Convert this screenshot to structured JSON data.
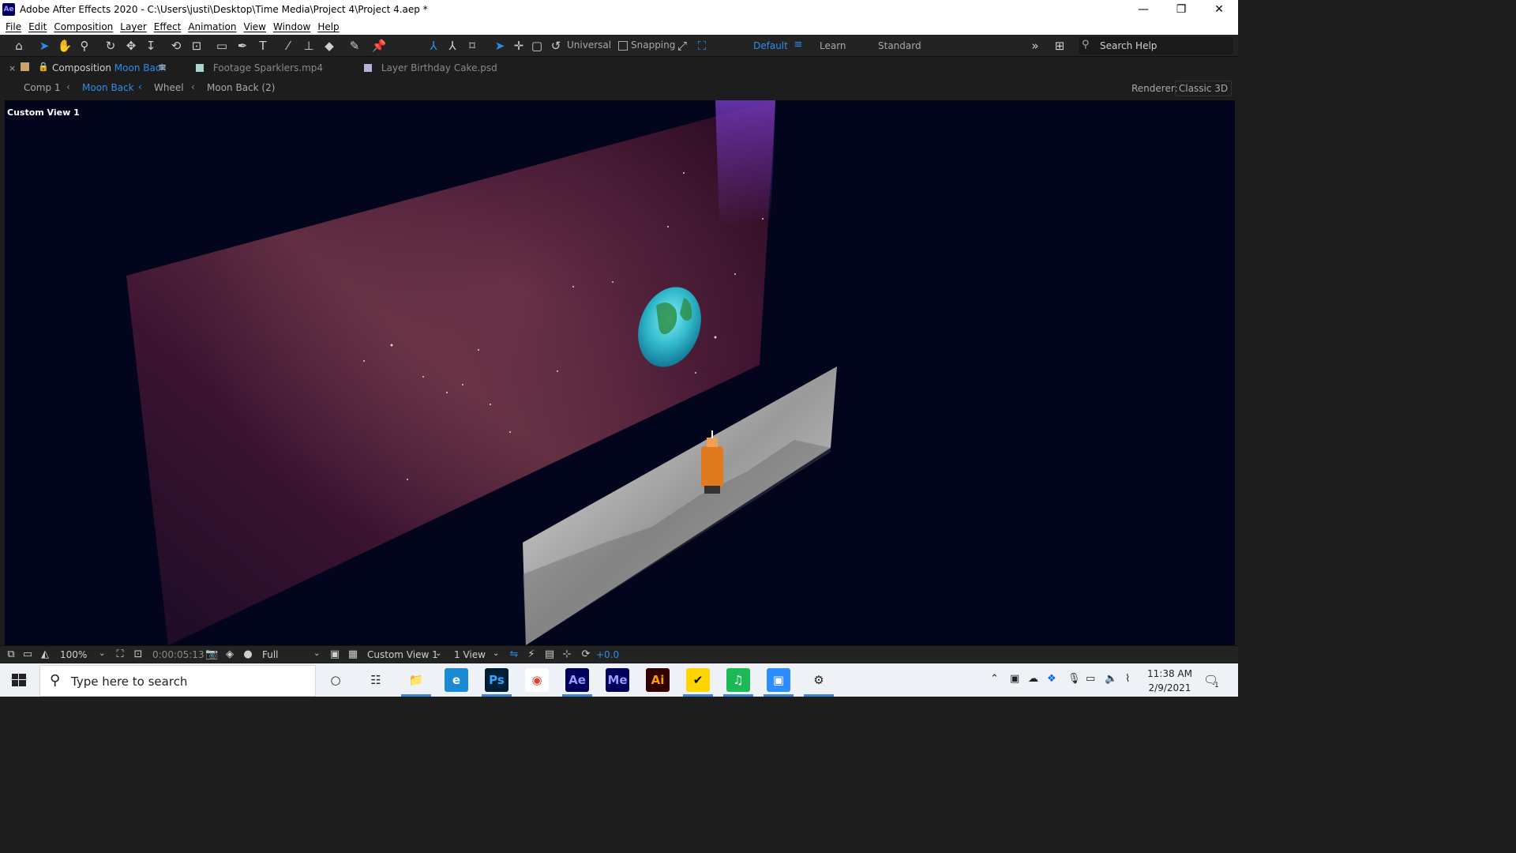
{
  "window": {
    "title": "Adobe After Effects 2020 - C:\\Users\\justi\\Desktop\\Time Media\\Project 4\\Project 4.aep *",
    "app_icon": "Ae",
    "minimize": "—",
    "restore": "❐",
    "close": "✕"
  },
  "menu": [
    "File",
    "Edit",
    "Composition",
    "Layer",
    "Effect",
    "Animation",
    "View",
    "Window",
    "Help"
  ],
  "toolbar": {
    "axis_mode": "Universal",
    "snapping_label": "Snapping",
    "workspaces": [
      "Default",
      "Learn",
      "Standard"
    ],
    "active_workspace": "Default",
    "overflow": "»",
    "search_placeholder": "Search Help"
  },
  "panel_tabs": [
    {
      "prefix": "Composition",
      "name": "Moon Back",
      "active": true,
      "swatch": "#c9a36a"
    },
    {
      "prefix": "Footage",
      "name": "Sparklers.mp4",
      "active": false,
      "swatch": "#a6d8d0"
    },
    {
      "prefix": "Layer",
      "name": "Birthday Cake.psd",
      "active": false,
      "swatch": "#b8b0d8"
    }
  ],
  "breadcrumb": [
    "Comp 1",
    "Moon Back",
    "Wheel",
    "Moon Back (2)"
  ],
  "renderer": {
    "label": "Renderer:",
    "value": "Classic 3D"
  },
  "viewer": {
    "view_name": "Custom View 1"
  },
  "viewer_footer": {
    "zoom": "100%",
    "timecode": "0:00:05:13",
    "resolution": "Full",
    "view": "Custom View 1",
    "view_layout": "1 View",
    "exposure": "+0.0"
  },
  "taskbar": {
    "search_placeholder": "Type here to search",
    "apps": [
      {
        "name": "cortana",
        "label": "○",
        "bg": "transparent",
        "fg": "#222222",
        "open": false
      },
      {
        "name": "task-view",
        "label": "☷",
        "bg": "transparent",
        "fg": "#222222",
        "open": false
      },
      {
        "name": "file-explorer",
        "label": "📁",
        "bg": "transparent",
        "fg": "#e8b12c",
        "open": true
      },
      {
        "name": "edge",
        "label": "e",
        "bg": "#1a8ad4",
        "fg": "#ffffff",
        "open": false
      },
      {
        "name": "photoshop",
        "label": "Ps",
        "bg": "#001e36",
        "fg": "#31a8ff",
        "open": true
      },
      {
        "name": "chrome",
        "label": "◉",
        "bg": "#ffffff",
        "fg": "#db4437",
        "open": false
      },
      {
        "name": "after-effects",
        "label": "Ae",
        "bg": "#00005b",
        "fg": "#9999ff",
        "open": true
      },
      {
        "name": "media-encoder",
        "label": "Me",
        "bg": "#00005b",
        "fg": "#9999ff",
        "open": false
      },
      {
        "name": "illustrator",
        "label": "Ai",
        "bg": "#330000",
        "fg": "#ff9a00",
        "open": false
      },
      {
        "name": "norton",
        "label": "✔",
        "bg": "#ffd500",
        "fg": "#000000",
        "open": true
      },
      {
        "name": "spotify",
        "label": "♫",
        "bg": "#1db954",
        "fg": "#ffffff",
        "open": true
      },
      {
        "name": "zoom",
        "label": "▣",
        "bg": "#2d8cff",
        "fg": "#ffffff",
        "open": true
      },
      {
        "name": "settings",
        "label": "⚙",
        "bg": "transparent",
        "fg": "#222222",
        "open": true
      }
    ],
    "time": "11:38 AM",
    "date": "2/9/2021",
    "notifications": "1"
  }
}
